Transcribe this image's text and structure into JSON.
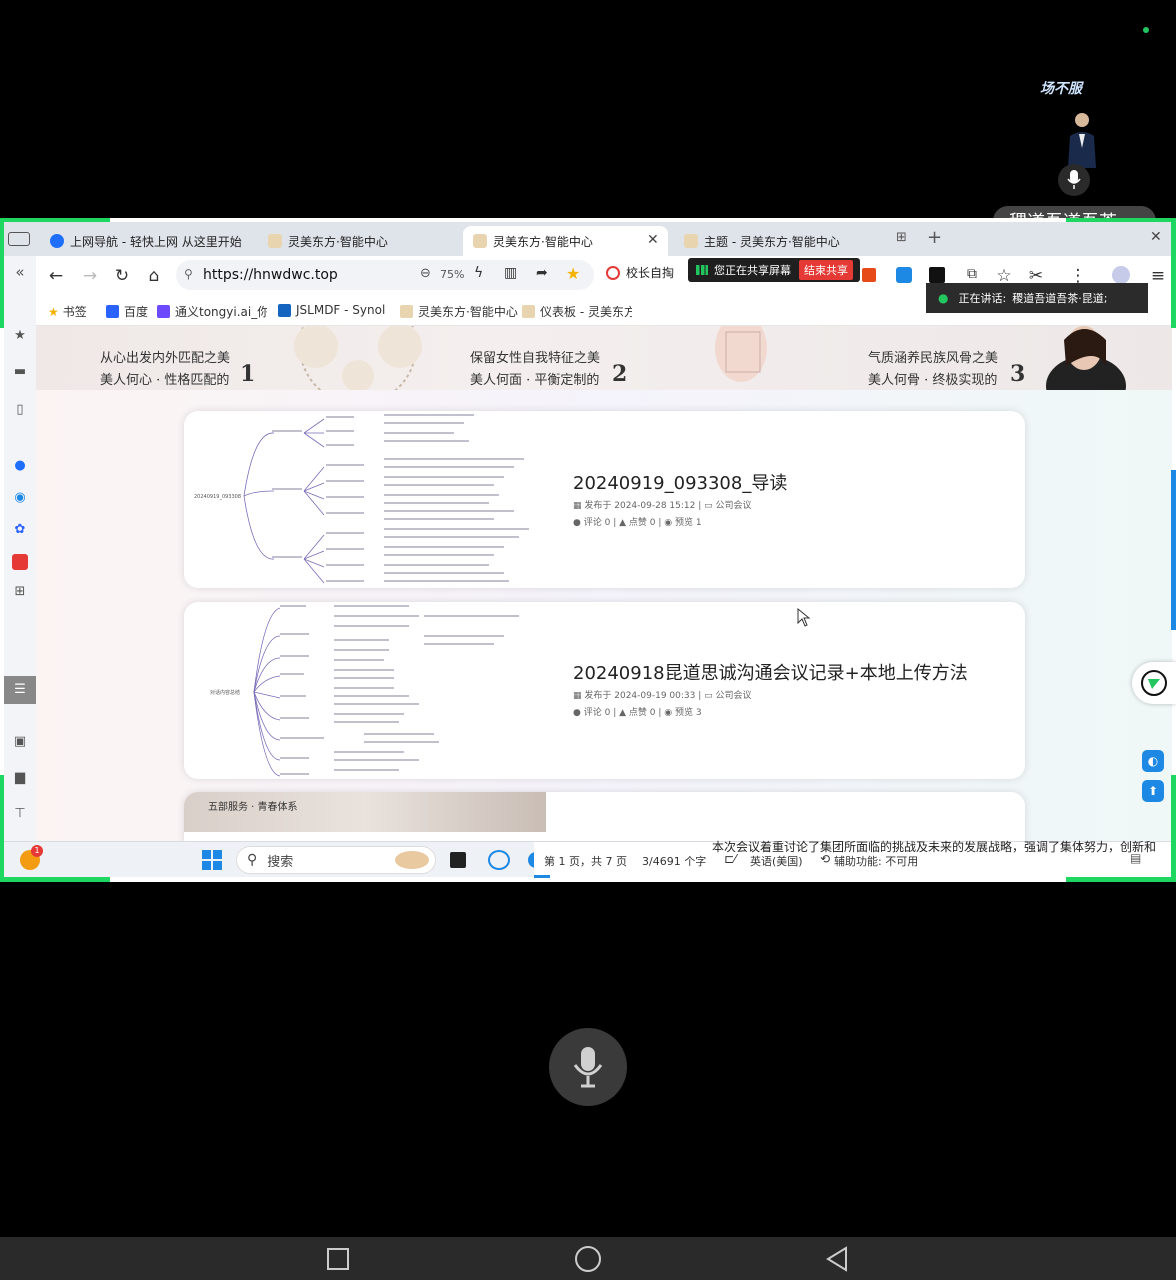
{
  "participant": {
    "top_name": "场不服",
    "pill_name": "稷道吾道吾茶 ..."
  },
  "browser": {
    "tabs": [
      {
        "label": "上网导航 - 轻快上网 从这里开始"
      },
      {
        "label": "灵美东方·智能中心"
      },
      {
        "label": "灵美东方·智能中心"
      },
      {
        "label": "主题 - 灵美东方·智能中心"
      }
    ],
    "url": "https://hnwdwc.top",
    "zoom": "75%",
    "school_label": "校长自掏"
  },
  "share_indicator": {
    "status": "您正在共享屏幕",
    "end_button": "结束共享",
    "talking_label": "正在讲话:",
    "talking_name": "稷道吾道吾茶·昆道;"
  },
  "bookmarks": [
    {
      "label": "书签"
    },
    {
      "label": "百度"
    },
    {
      "label": "通义tongyi.ai_你"
    },
    {
      "label": "JSLMDF - Synolo"
    },
    {
      "label": "灵美东方·智能中心"
    },
    {
      "label": "仪表板 - 灵美东方"
    }
  ],
  "banner": {
    "item1_line1": "从心出发内外匹配之美",
    "item1_line2": "美人何心 · 性格匹配的",
    "item1_num": "1",
    "item2_line1": "保留女性自我特征之美",
    "item2_line2": "美人何面 · 平衡定制的",
    "item2_num": "2",
    "item3_line1": "气质涵养民族风骨之美",
    "item3_line2": "美人何骨 · 终极实现的",
    "item3_num": "3"
  },
  "posts": [
    {
      "title": "20240919_093308_导读",
      "published": "发布于 2024-09-28 15:12",
      "category": "公司会议",
      "comments": "评论 0",
      "likes": "点赞 0",
      "views": "预览 1",
      "mindmap_root": "20240919_093308"
    },
    {
      "title": "20240918昆道思诚沟通会议记录+本地上传方法",
      "published": "发布于 2024-09-19 00:33",
      "category": "公司会议",
      "comments": "评论 0",
      "likes": "点赞 0",
      "views": "预览 3",
      "mindmap_root": "对话内容总结"
    }
  ],
  "card3": {
    "thumb_text": "五部服务 · 青春体系"
  },
  "taskbar": {
    "search": "搜索",
    "badge": "1"
  },
  "word_status": {
    "page": "第 1 页，共 7 页",
    "words": "3/4691 个字",
    "language": "英语(美国)",
    "accessibility": "辅助功能: 不可用"
  },
  "overflow_text": "本次会议着重讨论了集团所面临的挑战及未来的发展战略，强调了集体努力，创新和"
}
